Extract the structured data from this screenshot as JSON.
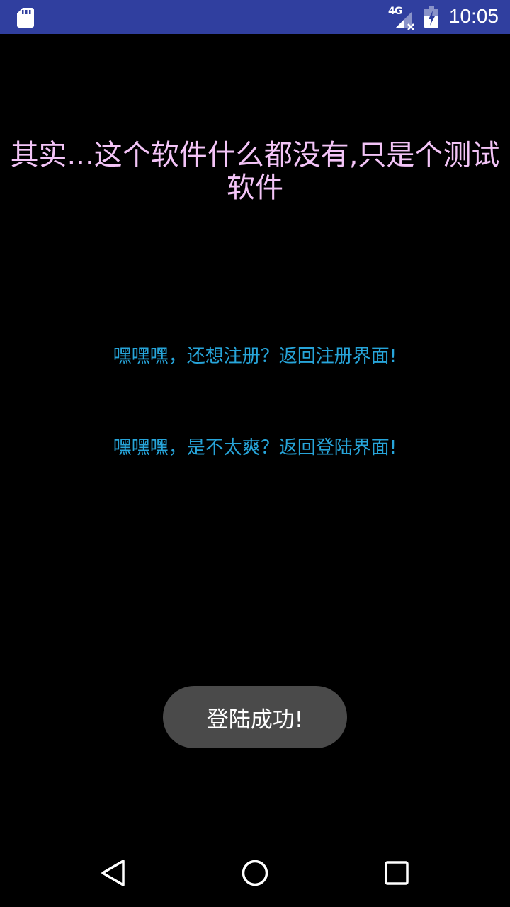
{
  "status_bar": {
    "network": "4G",
    "time": "10:05",
    "icons": [
      "sd-card-icon",
      "signal-icon",
      "battery-icon"
    ],
    "background_color": "#303f9f"
  },
  "main": {
    "title": "其实...这个软件什么都没有,只是个测试软件",
    "register_link": "嘿嘿嘿，还想注册？返回注册界面!",
    "login_link": "嘿嘿嘿，是不太爽？返回登陆界面!",
    "title_color": "#f3c4f7",
    "link_color": "#27a5da"
  },
  "toast": {
    "message": "登陆成功!"
  },
  "nav_bar": {
    "buttons": [
      "back-icon",
      "home-icon",
      "recents-icon"
    ]
  }
}
